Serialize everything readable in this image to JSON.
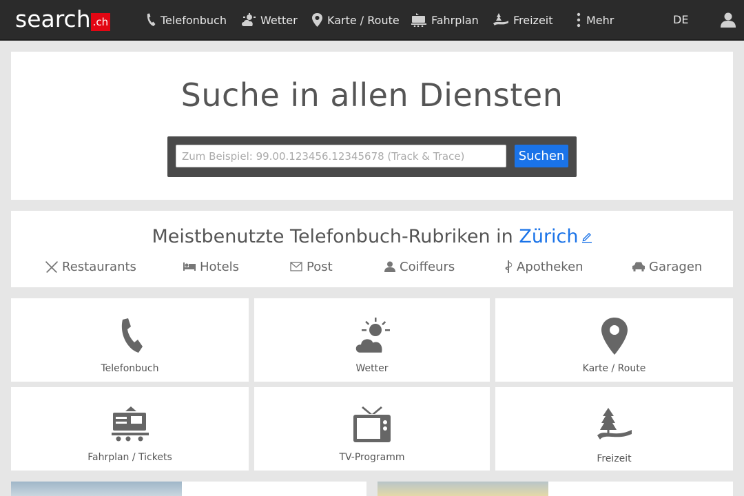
{
  "header": {
    "logo_text": "search",
    "logo_suffix": ".ch",
    "nav": [
      {
        "label": "Telefonbuch",
        "icon": "phone-icon"
      },
      {
        "label": "Wetter",
        "icon": "weather-icon"
      },
      {
        "label": "Karte / Route",
        "icon": "map-pin-icon"
      },
      {
        "label": "Fahrplan",
        "icon": "train-icon"
      },
      {
        "label": "Freizeit",
        "icon": "leisure-icon"
      },
      {
        "label": "Mehr",
        "icon": "more-vertical-icon"
      }
    ],
    "language": "DE",
    "user_icon": "user-icon"
  },
  "search": {
    "title": "Suche in allen Diensten",
    "placeholder": "Zum Beispiel: 99.00.123456.12345678 (Track & Trace)",
    "button_label": "Suchen"
  },
  "categories": {
    "title_prefix": "Meistbenutzte Telefonbuch-Rubriken in ",
    "city": "Zürich",
    "items": [
      {
        "label": "Restaurants",
        "icon": "cutlery-icon"
      },
      {
        "label": "Hotels",
        "icon": "bed-icon"
      },
      {
        "label": "Post",
        "icon": "envelope-icon"
      },
      {
        "label": "Coiffeurs",
        "icon": "person-icon"
      },
      {
        "label": "Apotheken",
        "icon": "pharmacy-icon"
      },
      {
        "label": "Garagen",
        "icon": "car-icon"
      }
    ]
  },
  "services": [
    {
      "label": "Telefonbuch",
      "icon": "phone-icon"
    },
    {
      "label": "Wetter",
      "icon": "weather-icon"
    },
    {
      "label": "Karte / Route",
      "icon": "map-pin-icon"
    },
    {
      "label": "Fahrplan / Tickets",
      "icon": "train-icon"
    },
    {
      "label": "TV-Programm",
      "icon": "tv-icon"
    },
    {
      "label": "Freizeit",
      "icon": "leisure-icon"
    }
  ],
  "colors": {
    "topbar": "#2b2b2b",
    "accent": "#1a73e8",
    "logo_red": "#e30613",
    "background": "#e6e6e6"
  }
}
